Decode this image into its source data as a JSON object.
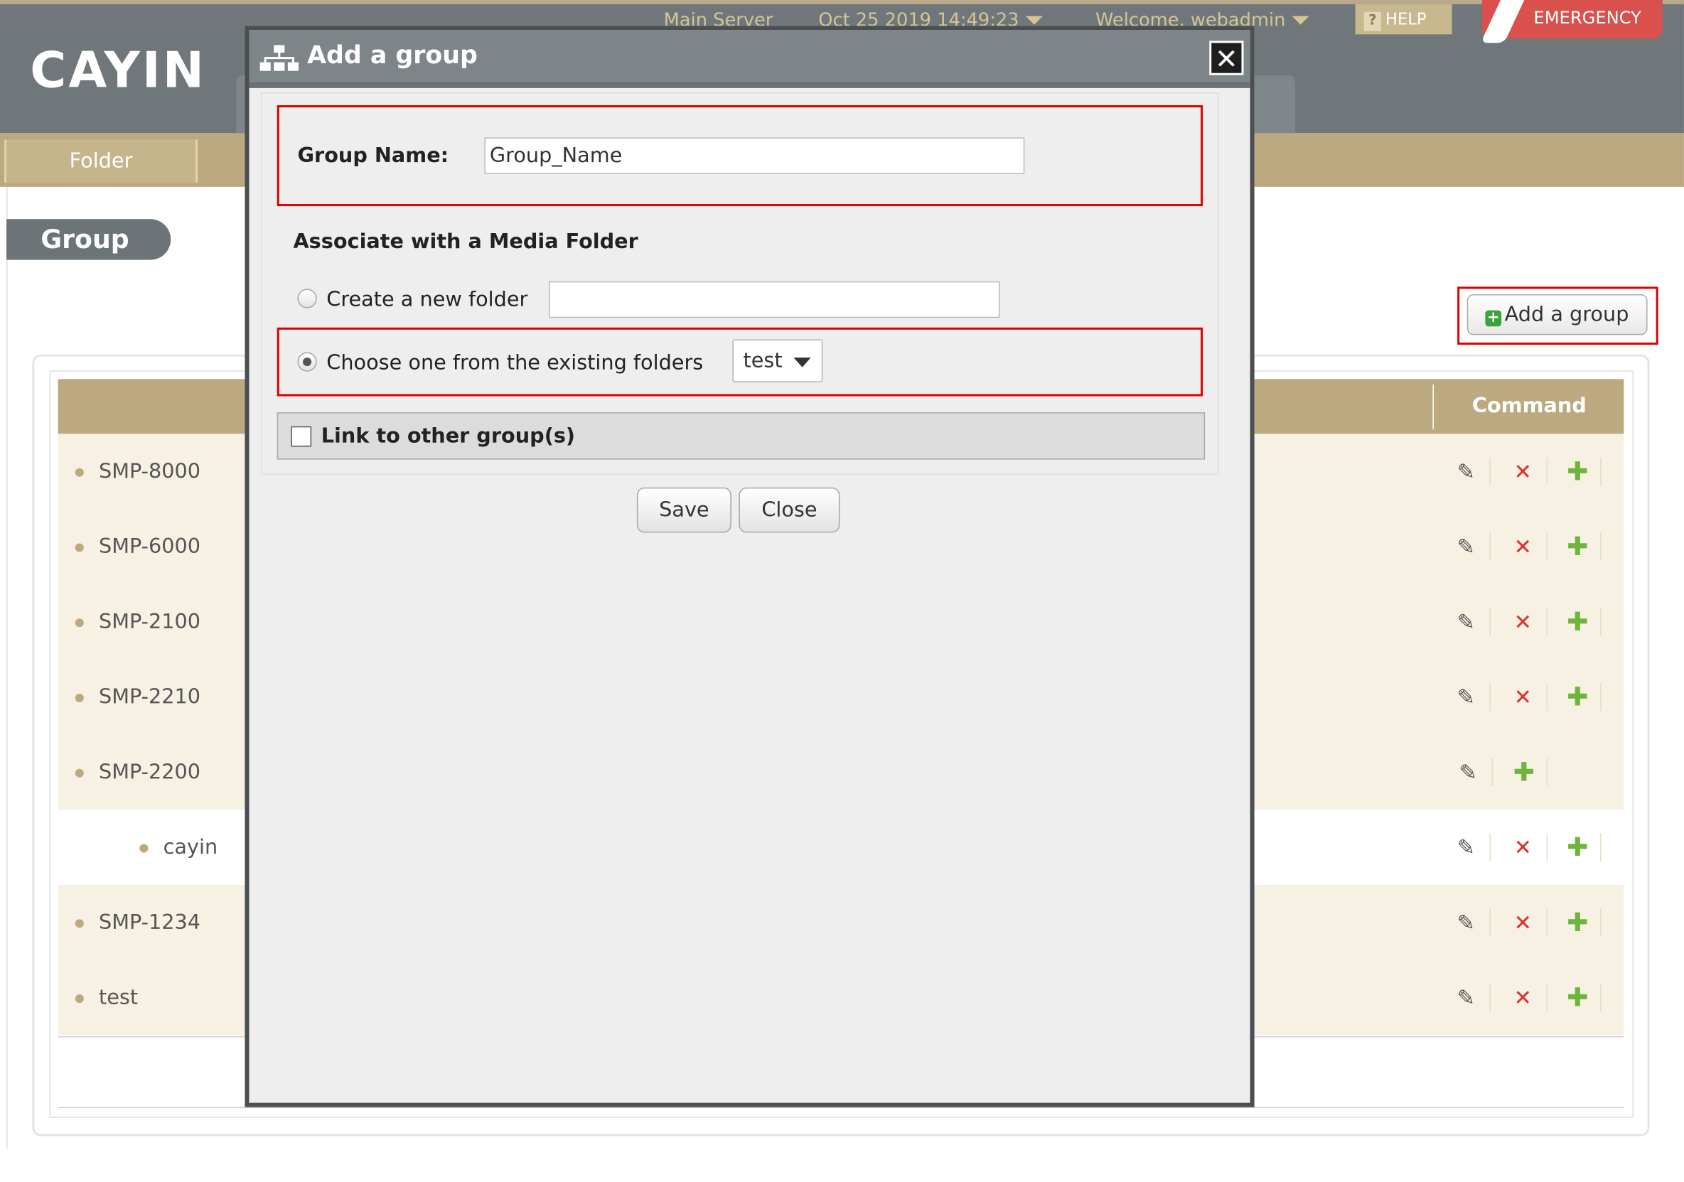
{
  "header": {
    "logo": "CAYIN",
    "server": "Main Server",
    "datetime": "Oct 25 2019 14:49:23",
    "welcome": "Welcome, webadmin",
    "help": "HELP",
    "help_icon": "?",
    "emergency": "EMERGENCY"
  },
  "nav": {
    "folder_tab": "Folder"
  },
  "page": {
    "section_title": "Group",
    "add_group_button": "Add a group",
    "table": {
      "command_header": "Command",
      "rows": [
        {
          "name": "SMP-8000",
          "can_delete": true
        },
        {
          "name": "SMP-6000",
          "can_delete": true
        },
        {
          "name": "SMP-2100",
          "can_delete": true
        },
        {
          "name": "SMP-2210",
          "can_delete": true
        },
        {
          "name": "SMP-2200",
          "can_delete": false
        },
        {
          "name": "cayin",
          "can_delete": true,
          "indent": 1
        },
        {
          "name": "SMP-1234",
          "can_delete": true
        },
        {
          "name": "test",
          "can_delete": true
        }
      ]
    }
  },
  "modal": {
    "title": "Add a group",
    "close_icon": "✕",
    "group_name_label": "Group Name:",
    "group_name_value": "Group_Name",
    "associate_heading": "Associate with a Media Folder",
    "create_new_folder_label": "Create a new folder",
    "create_new_folder_value": "",
    "choose_existing_label": "Choose one from the existing folders",
    "existing_folder_selected": "test",
    "link_label": "Link to other group(s)",
    "link_checked": false,
    "save_button": "Save",
    "close_button": "Close"
  },
  "icons": {
    "edit": "✎",
    "delete": "✕",
    "add": "✚",
    "add_group_plus": "+"
  },
  "colors": {
    "header_bg": "#6f777b",
    "accent_tan": "#bda980",
    "row_bg": "#f6f1e2",
    "highlight_red": "#e00000",
    "emergency_red": "#d9504d",
    "delete_red": "#d9332e",
    "add_green": "#6fb53d"
  }
}
